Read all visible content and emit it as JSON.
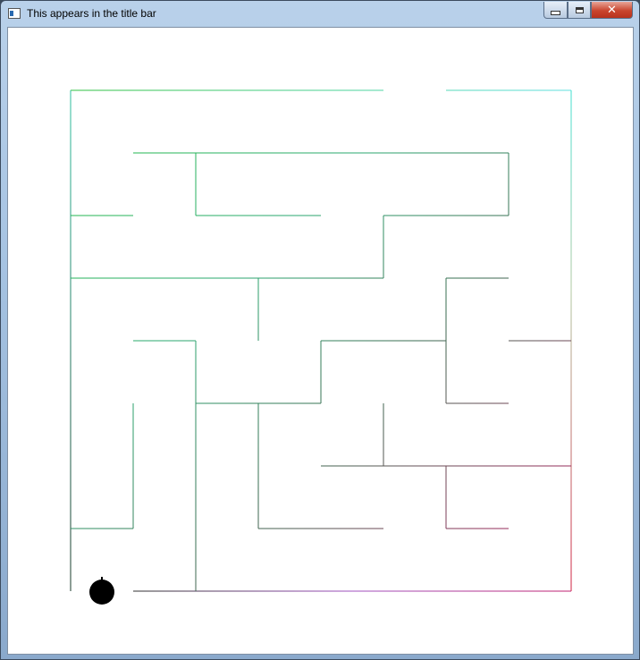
{
  "window": {
    "title": "This appears in the title bar",
    "close_glyph": "✕",
    "min_icon": "minimize-icon",
    "max_icon": "maximize-icon"
  },
  "game": {
    "player_color": "#000000",
    "background": "#ffffff"
  }
}
